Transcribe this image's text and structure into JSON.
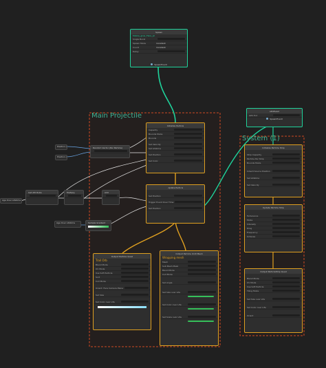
{
  "colors": {
    "background": "#202020",
    "selected_node_green": "#1fd49c",
    "selected_node_yellow": "#e0a020",
    "system_border": "#d24a22",
    "system_title": "#3db495",
    "wire_green": "#1fd49c",
    "wire_yellow": "#e0a020",
    "wire_white": "#e8e8e8",
    "wire_blue": "#6aa6e6"
  },
  "spawn_node": {
    "title": "Spawn",
    "subtitle": "Mobile_glow_Flare_pt",
    "rows": [
      "Single Burst",
      "Spawn Mode",
      "Count",
      "Delay"
    ],
    "values": [
      "",
      "Constant",
      "Constant",
      ""
    ],
    "event_label": "SpawnEvent"
  },
  "system_main": {
    "title": "Main Projectile",
    "init_node": {
      "title": "Initialize Particle",
      "rows": [
        "Capacity",
        "Bounds Mode",
        "Bounds",
        "Set Velocity",
        "Set Lifetime",
        "Set Position",
        "Set Color"
      ]
    },
    "update_node": {
      "title": "Update Particle",
      "rows": [
        "Set Position",
        "Trigger Event Over Time",
        "Set Position"
      ]
    },
    "output_quad": {
      "title": "Output Particle Quad",
      "badge": "Trail Orb",
      "rows": [
        "Blend Mode",
        "UV Mode",
        "Use Soft Particle",
        "Sort",
        "Cull Mode",
        "Orient: Face Camera Plane",
        "Set Size",
        "Set Color over Life"
      ]
    },
    "output_mesh": {
      "title": "Output Particle Unlit Mesh",
      "badge": "Wrapping mesh",
      "rows": [
        "Mesh",
        "Sub Mesh Mask",
        "Blend Mode",
        "Cull Mode",
        "Set Angle",
        "Set Size over Life",
        "Set Color over Life",
        "Set Scale over Life"
      ]
    }
  },
  "system_secondary": {
    "title": "System (1)",
    "gpu_event": {
      "title": "GPUEvent",
      "subtitle": "GPU Evt",
      "port": "SpawnEvent"
    },
    "init_strip": {
      "title": "Initialize Particle Strip",
      "rows": [
        "Strip Capacity",
        "Particle Per Strip",
        "Bounds Mode",
        "Inherit Source Position",
        "Set Lifetime",
        "Set Velocity"
      ]
    },
    "update_strip": {
      "title": "Update Particle Strip",
      "rows": [
        "Turbulence",
        "Mode",
        "Intensity",
        "Drag",
        "Frequency",
        "Octaves"
      ]
    },
    "output_strip": {
      "title": "Output ParticleStrip Quad",
      "rows": [
        "Blend Mode",
        "UV Mode",
        "Use Soft Particle",
        "Tiling Mode",
        "Set Size over Life",
        "Set Color over Life",
        "Orient"
      ]
    }
  },
  "operators": [
    {
      "name": "Position (World)"
    },
    {
      "name": "Position (Local)"
    },
    {
      "name": "Random Vector (Per Particle)"
    },
    {
      "name": "Multiply"
    },
    {
      "name": "Add"
    },
    {
      "name": "Sample Gradient"
    },
    {
      "name": "Age Over Lifetime"
    },
    {
      "name": "Get Attribute"
    }
  ]
}
